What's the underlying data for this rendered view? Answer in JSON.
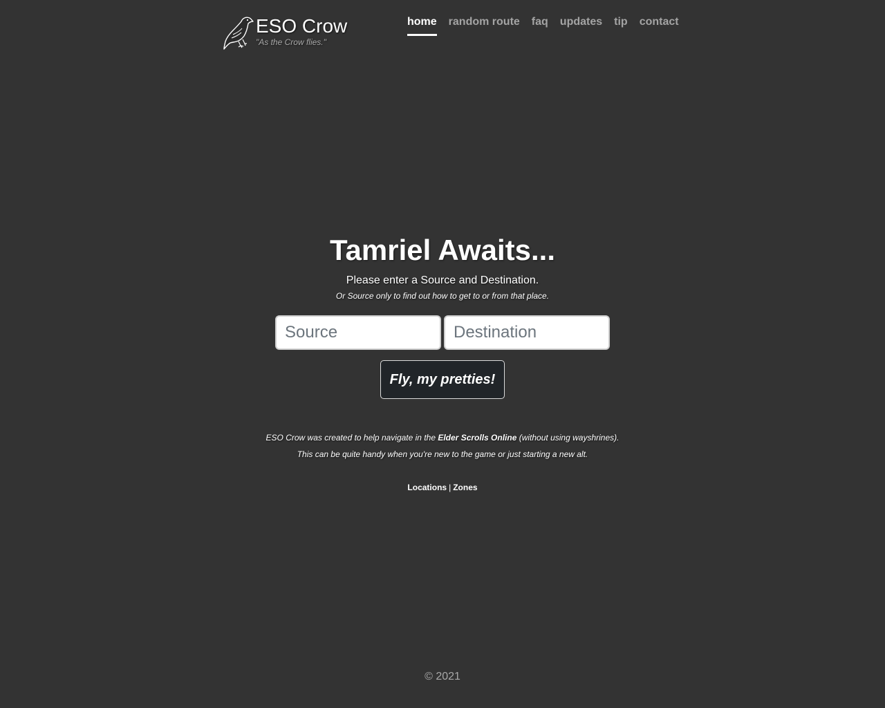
{
  "brand": {
    "title": "ESO Crow",
    "tagline": "\"As the Crow flies.\"",
    "logo_icon": "crow-icon"
  },
  "nav": {
    "items": [
      {
        "label": "home",
        "active": true
      },
      {
        "label": "random route",
        "active": false
      },
      {
        "label": "faq",
        "active": false
      },
      {
        "label": "updates",
        "active": false
      },
      {
        "label": "tip",
        "active": false
      },
      {
        "label": "contact",
        "active": false
      }
    ]
  },
  "main": {
    "headline": "Tamriel Awaits...",
    "lead": "Please enter a Source and Destination.",
    "sub": "Or Source only to find out how to get to or from that place.",
    "source_placeholder": "Source",
    "destination_placeholder": "Destination",
    "submit_label": "Fly, my pretties!"
  },
  "about": {
    "line1_pre": "ESO Crow was created to help navigate in the ",
    "line1_bold": "Elder Scrolls Online",
    "line1_post": " (without using wayshrines).",
    "line2": "This can be quite handy when you're new to the game or just starting a new alt."
  },
  "links": {
    "locations": "Locations",
    "separator": "|",
    "zones": "Zones"
  },
  "footer": {
    "copyright": "© 2021"
  },
  "colors": {
    "background": "#333333",
    "nav_inactive": "#a4a4a4",
    "button_bg": "#212529"
  }
}
